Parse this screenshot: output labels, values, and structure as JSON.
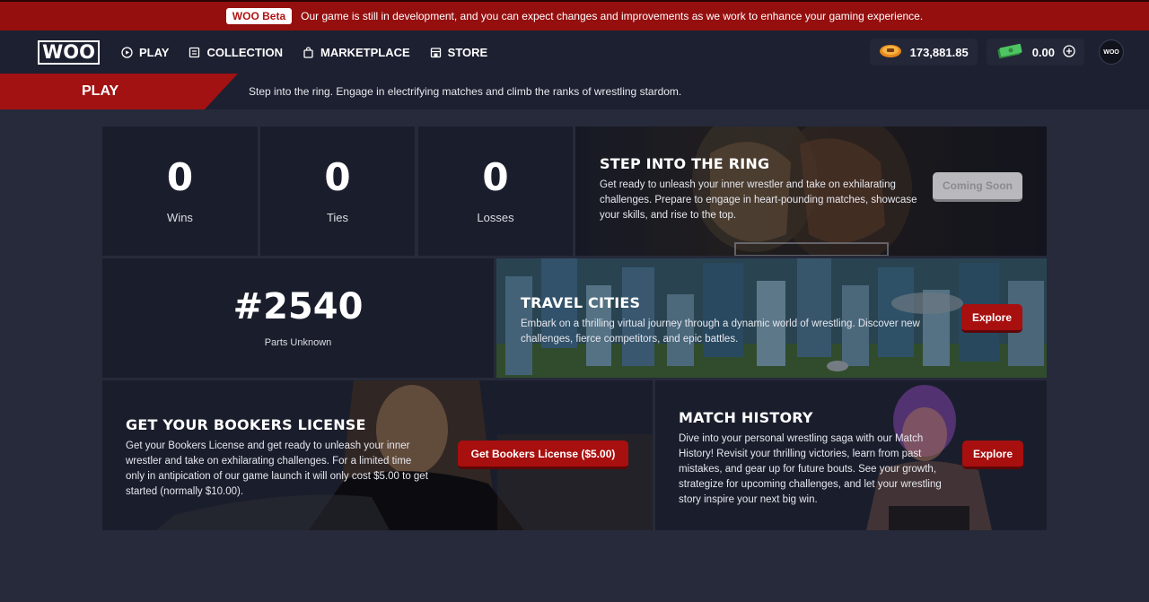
{
  "beta_banner": {
    "badge": "WOO Beta",
    "message": "Our game is still in development, and you can expect changes and improvements as we work to enhance your gaming experience."
  },
  "nav": {
    "logo": "WOO",
    "items": [
      {
        "label": "PLAY",
        "icon": "play-circle-icon"
      },
      {
        "label": "COLLECTION",
        "icon": "collection-icon"
      },
      {
        "label": "MARKETPLACE",
        "icon": "marketplace-bag-icon"
      },
      {
        "label": "STORE",
        "icon": "store-icon"
      }
    ],
    "coins": "173,881.85",
    "cash": "0.00",
    "avatar_text": "WOO"
  },
  "page": {
    "title": "PLAY",
    "subtitle": "Step into the ring. Engage in electrifying matches and climb the ranks of wrestling stardom."
  },
  "stats": [
    {
      "value": "0",
      "label": "Wins"
    },
    {
      "value": "0",
      "label": "Ties"
    },
    {
      "value": "0",
      "label": "Losses"
    }
  ],
  "ring_card": {
    "title": "STEP INTO THE RING",
    "text": "Get ready to unleash your inner wrestler and take on exhilarating challenges. Prepare to engage in heart-pounding matches, showcase your skills, and rise to the top.",
    "button": "Coming Soon"
  },
  "rank_card": {
    "rank": "#2540",
    "location": "Parts Unknown"
  },
  "travel_card": {
    "title": "TRAVEL CITIES",
    "text": "Embark on a thrilling virtual journey through a dynamic world of wrestling. Discover new challenges, fierce competitors, and epic battles.",
    "button": "Explore"
  },
  "license_card": {
    "title": "GET YOUR BOOKERS LICENSE",
    "text": "Get your Bookers License and get ready to unleash your inner wrestler and take on exhilarating challenges. For a limited time only in antipication of our game launch it will only cost $5.00 to get started (normally $10.00).",
    "button": "Get Bookers License ($5.00)"
  },
  "history_card": {
    "title": "MATCH HISTORY",
    "text": "Dive into your personal wrestling saga with our Match History! Revisit your thrilling victories, learn from past mistakes, and gear up for future bouts. See your growth, strategize for upcoming challenges, and let your wrestling story inspire your next big win.",
    "button": "Explore"
  },
  "colors": {
    "background": "#262a3a",
    "nav": "#1c2030",
    "card": "#1a1e2c",
    "accent_red": "#a80f0f",
    "banner_red": "#950f0f"
  }
}
